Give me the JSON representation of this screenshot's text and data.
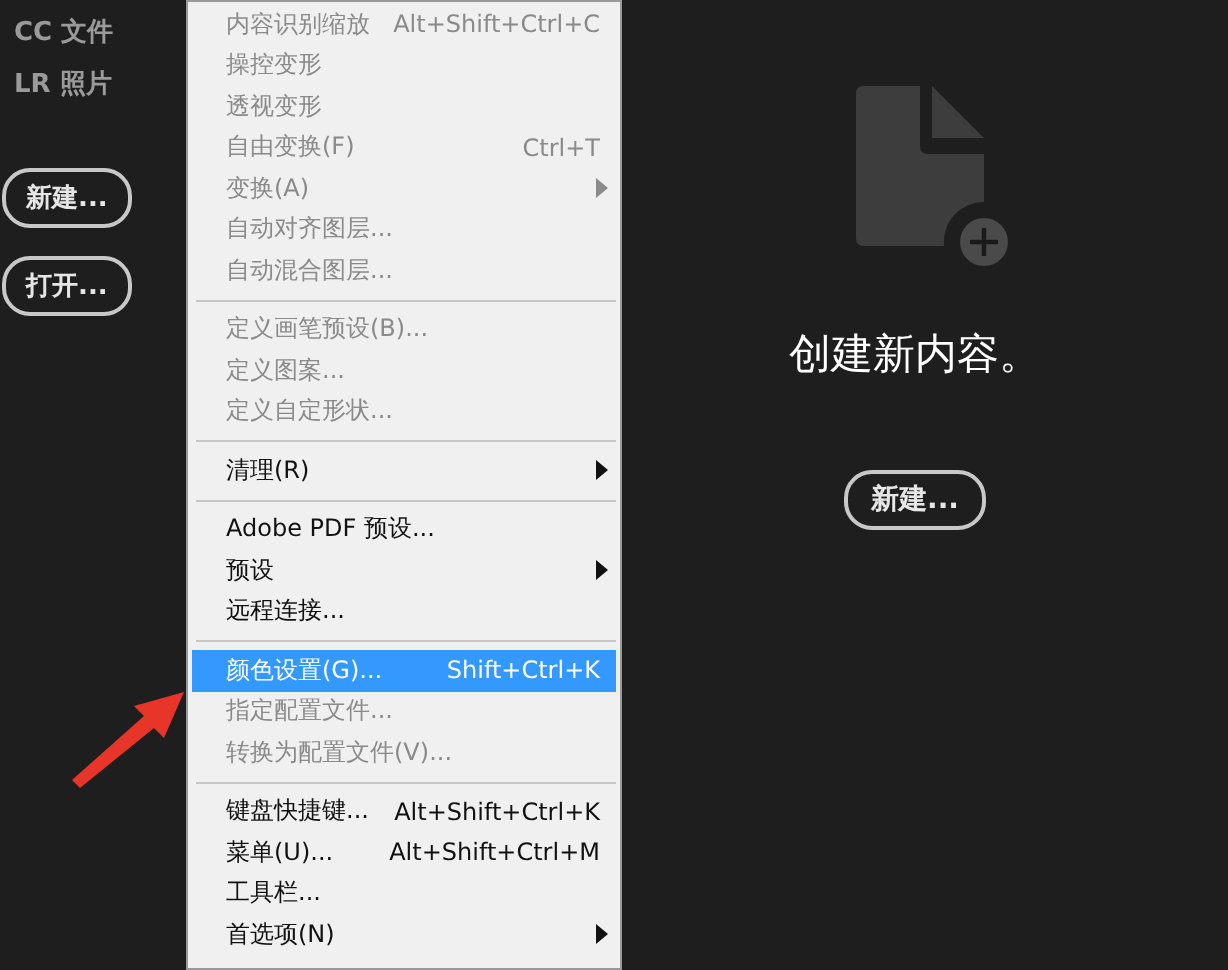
{
  "sidebar": {
    "links": [
      "CC 文件",
      "LR 照片"
    ],
    "buttons": [
      "新建...",
      "打开..."
    ]
  },
  "start": {
    "heading": "创建新内容。",
    "button": "新建..."
  },
  "menu": {
    "groups": [
      [
        {
          "label": "内容识别缩放",
          "shortcut": "Alt+Shift+Ctrl+C",
          "disabled": true,
          "submenu": false,
          "selected": false
        },
        {
          "label": "操控变形",
          "disabled": true,
          "submenu": false,
          "selected": false
        },
        {
          "label": "透视变形",
          "disabled": true,
          "submenu": false,
          "selected": false
        },
        {
          "label": "自由变换(F)",
          "shortcut": "Ctrl+T",
          "disabled": true,
          "submenu": false,
          "selected": false
        },
        {
          "label": "变换(A)",
          "disabled": true,
          "submenu": true,
          "selected": false
        },
        {
          "label": "自动对齐图层...",
          "disabled": true,
          "submenu": false,
          "selected": false
        },
        {
          "label": "自动混合图层...",
          "disabled": true,
          "submenu": false,
          "selected": false
        }
      ],
      [
        {
          "label": "定义画笔预设(B)...",
          "disabled": true,
          "submenu": false,
          "selected": false
        },
        {
          "label": "定义图案...",
          "disabled": true,
          "submenu": false,
          "selected": false
        },
        {
          "label": "定义自定形状...",
          "disabled": true,
          "submenu": false,
          "selected": false
        }
      ],
      [
        {
          "label": "清理(R)",
          "disabled": false,
          "submenu": true,
          "selected": false
        }
      ],
      [
        {
          "label": "Adobe PDF 预设...",
          "disabled": false,
          "submenu": false,
          "selected": false
        },
        {
          "label": "预设",
          "disabled": false,
          "submenu": true,
          "selected": false
        },
        {
          "label": "远程连接...",
          "disabled": false,
          "submenu": false,
          "selected": false
        }
      ],
      [
        {
          "label": "颜色设置(G)...",
          "shortcut": "Shift+Ctrl+K",
          "disabled": false,
          "submenu": false,
          "selected": true
        },
        {
          "label": "指定配置文件...",
          "disabled": true,
          "submenu": false,
          "selected": false
        },
        {
          "label": "转换为配置文件(V)...",
          "disabled": true,
          "submenu": false,
          "selected": false
        }
      ],
      [
        {
          "label": "键盘快捷键...",
          "shortcut": "Alt+Shift+Ctrl+K",
          "disabled": false,
          "submenu": false,
          "selected": false
        },
        {
          "label": "菜单(U)...",
          "shortcut": "Alt+Shift+Ctrl+M",
          "disabled": false,
          "submenu": false,
          "selected": false
        },
        {
          "label": "工具栏...",
          "disabled": false,
          "submenu": false,
          "selected": false
        },
        {
          "label": "首选项(N)",
          "disabled": false,
          "submenu": true,
          "selected": false
        }
      ]
    ]
  }
}
